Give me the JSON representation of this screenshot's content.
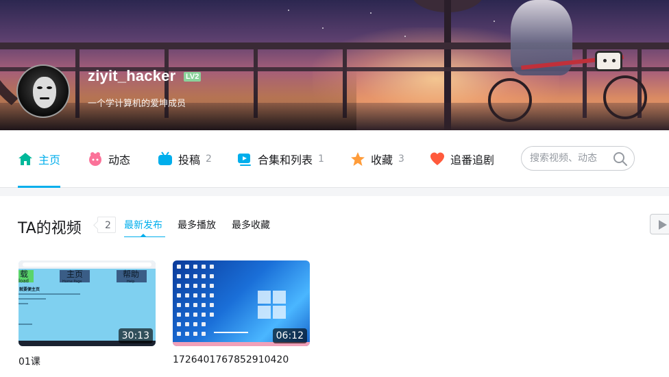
{
  "profile": {
    "username": "ziyit_hacker",
    "level_badge": "LV2",
    "signature": "一个学计算机的爱坤成员"
  },
  "nav": {
    "items": [
      {
        "label": "主页",
        "count": "",
        "icon": "home-icon",
        "active": true
      },
      {
        "label": "动态",
        "count": "",
        "icon": "dynamic-icon",
        "active": false
      },
      {
        "label": "投稿",
        "count": "2",
        "icon": "tv-icon",
        "active": false
      },
      {
        "label": "合集和列表",
        "count": "1",
        "icon": "playlist-icon",
        "active": false
      },
      {
        "label": "收藏",
        "count": "3",
        "icon": "star-icon",
        "active": false
      },
      {
        "label": "追番追剧",
        "count": "",
        "icon": "heart-icon",
        "active": false
      }
    ],
    "search_placeholder": "搜索视频、动态"
  },
  "videos_section": {
    "title": "TA的视频",
    "count": "2",
    "sort_tabs": [
      "最新发布",
      "最多播放",
      "最多收藏"
    ],
    "active_sort": "最新发布",
    "videos": [
      {
        "title": "01课",
        "duration": "30:13",
        "thumb_text": {
          "btn1": "载",
          "btn1_sub": "load",
          "btn2": "主页",
          "btn2_sub": "Home Page",
          "btn3": "帮助",
          "btn3_sub": "Help",
          "heading": "就要便主页"
        }
      },
      {
        "title": "1726401767852910420",
        "duration": "06:12"
      }
    ]
  },
  "colors": {
    "accent": "#00aeec",
    "home_icon": "#00b89a",
    "dynamic_icon": "#fb7299",
    "tv_icon": "#00aeec",
    "playlist_icon": "#00aeec",
    "star_icon": "#ff9c3a",
    "heart_icon": "#ff5a3c",
    "level_badge": "#8bd29b"
  }
}
